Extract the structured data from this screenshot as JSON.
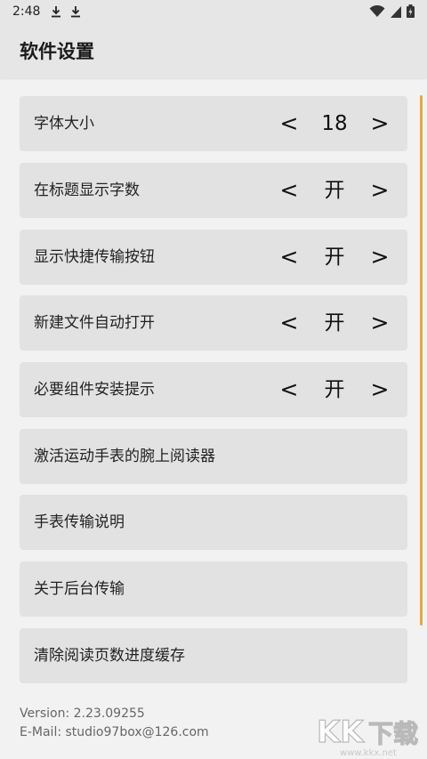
{
  "status_bar": {
    "time": "2:48",
    "icons": [
      "download-icon",
      "download-icon",
      "wifi-icon",
      "signal-icon",
      "battery-icon"
    ]
  },
  "app_bar": {
    "title": "软件设置"
  },
  "settings": [
    {
      "label": "字体大小",
      "value": "18",
      "left": "<",
      "right": ">"
    },
    {
      "label": "在标题显示字数",
      "value": "开",
      "left": "<",
      "right": ">"
    },
    {
      "label": "显示快捷传输按钮",
      "value": "开",
      "left": "<",
      "right": ">"
    },
    {
      "label": "新建文件自动打开",
      "value": "开",
      "left": "<",
      "right": ">"
    },
    {
      "label": "必要组件安装提示",
      "value": "开",
      "left": "<",
      "right": ">"
    },
    {
      "label": "激活运动手表的腕上阅读器"
    },
    {
      "label": "手表传输说明"
    },
    {
      "label": "关于后台传输"
    },
    {
      "label": "清除阅读页数进度缓存"
    }
  ],
  "footer": {
    "version": "Version: 2.23.09255",
    "email": "E-Mail: studio97box@126.com"
  },
  "watermark": {
    "text": "KK下载",
    "url": "www.kkx.net"
  },
  "colors": {
    "accent": "#e8a93a",
    "row_bg": "#e2e2e2",
    "bg": "#f2f2f2"
  }
}
